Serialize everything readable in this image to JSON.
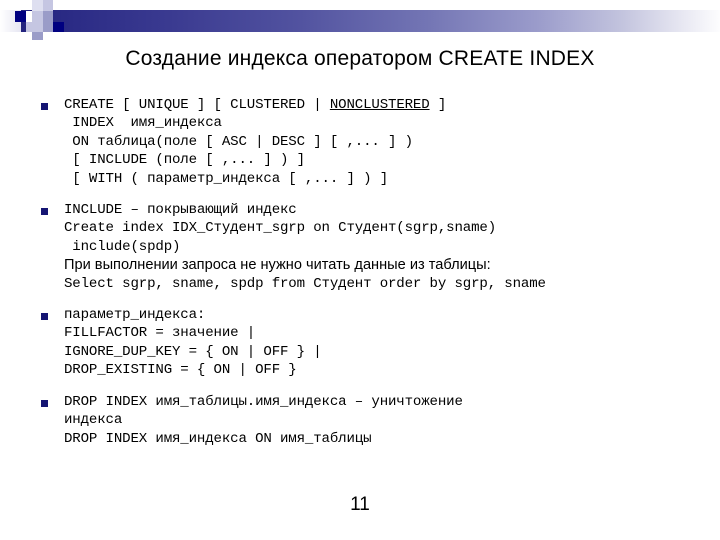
{
  "slide": {
    "title": "Создание индекса оператором CREATE INDEX",
    "page_number": "11",
    "accent_color": "#000080",
    "bullet_color": "#151573",
    "gradient_start": "#23237e",
    "gradient_end": "#fdfdfe"
  },
  "bullets": [
    {
      "id": "create-index-syntax",
      "lines": [
        {
          "text": "CREATE [ UNIQUE ] [ CLUSTERED | ",
          "style": "mono",
          "underline_tail": "NONCLUSTERED",
          "tail": " ]"
        },
        {
          "text": " INDEX  имя_индекса",
          "style": "mono"
        },
        {
          "text": " ON таблица(поле [ ASC | DESC ] [ ,... ] )",
          "style": "mono"
        },
        {
          "text": " [ INCLUDE (поле [ ,... ] ) ]",
          "style": "mono"
        },
        {
          "text": " [ WITH ( параметр_индекса [ ,... ] ) ]",
          "style": "mono"
        }
      ]
    },
    {
      "id": "include-covering-index",
      "lines": [
        {
          "text": "INCLUDE – покрывающий индекс",
          "style": "mono"
        },
        {
          "text": "Create index IDX_Студент_sgrp on Студент(sgrp,sname)",
          "style": "mono"
        },
        {
          "text": " include(spdp)",
          "style": "mono"
        },
        {
          "text": "При выполнении запроса не нужно читать данные из таблицы:",
          "style": "sans"
        },
        {
          "text": "Select sgrp, sname, spdp from Студент order by sgrp, sname",
          "style": "mono"
        }
      ]
    },
    {
      "id": "index-parameters",
      "lines": [
        {
          "text": "параметр_индекса:",
          "style": "mono"
        },
        {
          "text": "FILLFACTOR = значение |",
          "style": "mono"
        },
        {
          "text": "IGNORE_DUP_KEY = { ON | OFF } |",
          "style": "mono"
        },
        {
          "text": "DROP_EXISTING = { ON | OFF }",
          "style": "mono"
        }
      ]
    },
    {
      "id": "drop-index",
      "lines": [
        {
          "text": "DROP INDEX имя_таблицы.имя_индекса – уничтожение",
          "style": "mono"
        },
        {
          "text": "индекса",
          "style": "mono"
        },
        {
          "text": "DROP INDEX имя_индекса ON имя_таблицы",
          "style": "mono"
        }
      ]
    }
  ]
}
